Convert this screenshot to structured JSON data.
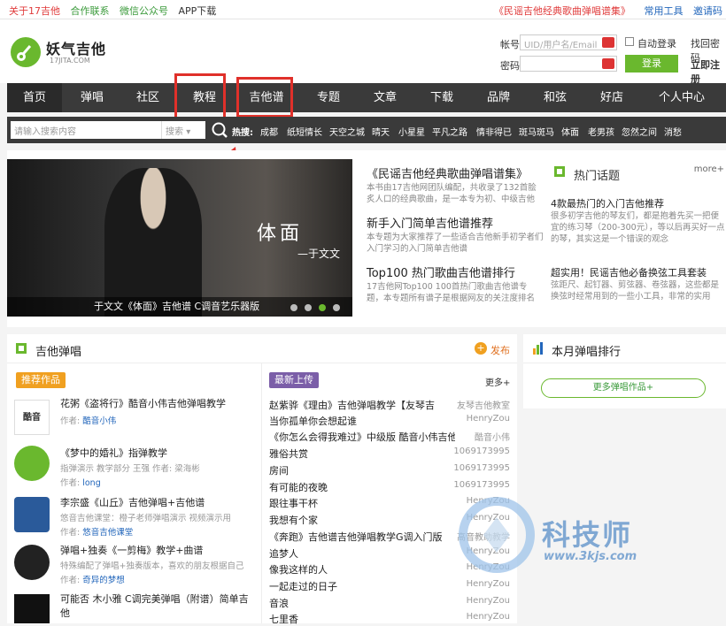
{
  "topbar": {
    "links": [
      "关于17吉他",
      "合作联系",
      "微信公众号",
      "APP下载"
    ],
    "promo": "《民谣吉他经典歌曲弹唱谱集》",
    "tools": "常用工具",
    "invite": "邀请码"
  },
  "header": {
    "logo_text": "妖气吉他",
    "logo_sub": "17JITA.COM",
    "account_label": "帐号",
    "account_placeholder": "UID/用户名/Email",
    "auto_login": "自动登录",
    "find_password": "找回密码",
    "password_label": "密码",
    "login_btn": "登录",
    "register": "立即注册"
  },
  "nav": [
    "首页",
    "弹唱",
    "社区",
    "教程",
    "吉他谱",
    "专题",
    "文章",
    "下载",
    "品牌",
    "和弦",
    "好店",
    "个人中心"
  ],
  "search": {
    "placeholder": "请输入搜索内容",
    "select": "搜索",
    "hot_label": "热搜:",
    "hot": [
      "成都",
      "纸短情长",
      "天空之城",
      "晴天",
      "小星星",
      "平凡之路",
      "情非得已",
      "斑马斑马",
      "体面",
      "老男孩",
      "忽然之间",
      "消愁"
    ]
  },
  "banner": {
    "title": "体面",
    "sub": "—于文文",
    "caption": "于文文《体面》吉他谱 C调音艺乐器版"
  },
  "articles": [
    {
      "title": "《民谣吉他经典歌曲弹唱谱集》",
      "desc": "本书由17吉他网团队编配，共收录了132首脍炙人口的经典歌曲，是一本专为初、中级吉他"
    },
    {
      "title": "新手入门简单吉他谱推荐",
      "desc": "本专题为大家推荐了一些适合吉他新手初学者们入门学习的入门简单吉他谱"
    },
    {
      "title": "Top100 热门歌曲吉他谱排行",
      "desc": "17吉他网Top100 100首热门歌曲吉他谱专题，本专题所有谱子是根据网友的关注度排名"
    }
  ],
  "hot_topics": {
    "title": "热门话题",
    "more": "more+",
    "items": [
      {
        "title": "4款最热门的入门吉他推荐",
        "desc": "很多初学吉他的琴友们，都是抱着先买一把便宜的练习琴（200-300元），等以后再买好一点的琴，其实这是一个错误的观念"
      },
      {
        "title": "超实用！民谣吉他必备换弦工具套装",
        "desc": "弦距尺、起钉器、剪弦器、卷弦器，这些都是换弦时经常用到的一些小工具，非常的实用"
      }
    ]
  },
  "guitar_section": {
    "title": "吉他弹唱",
    "publish": "发布",
    "recommend_tag": "推荐作品",
    "new_tag": "最新上传",
    "more": "更多+"
  },
  "recommend": [
    {
      "title": "花粥《盗将行》酷音小伟吉他弹唱教学",
      "author_label": "作者:",
      "author": "酷音小伟",
      "desc": ""
    },
    {
      "title": "《梦中的婚礼》指弹教学",
      "desc": "指弹演示 教学部分 王强 作者: 梁海彬",
      "author_label": "作者:",
      "author": "long"
    },
    {
      "title": "李宗盛《山丘》吉他弹唱+吉他谱",
      "desc": "悠音吉他课堂：橙子老师弹唱演示 视频演示用",
      "author_label": "作者:",
      "author": "悠音吉他课堂"
    },
    {
      "title": "弹唱+独奏《一剪梅》教学+曲谱",
      "desc": "特殊编配了弹唱+独奏版本，喜欢的朋友根据自己",
      "author_label": "作者:",
      "author": "奇异的梦想"
    },
    {
      "title": "可能否 木小雅 C调完美弹唱（附谱）简单吉他",
      "desc": "",
      "author_label": "",
      "author": ""
    }
  ],
  "new_uploads": [
    {
      "t": "赵紫骅《理由》吉他弹唱教学【友琴吉",
      "u": "友琴吉他教室"
    },
    {
      "t": "当你孤单你会想起谁",
      "u": "HenryZou"
    },
    {
      "t": "《你怎么会得我难过》中级版 酷音小伟吉他",
      "u": "酷音小伟"
    },
    {
      "t": "雅俗共赏",
      "u": "1069173995"
    },
    {
      "t": "房间",
      "u": "1069173995"
    },
    {
      "t": "有可能的夜晚",
      "u": "1069173995"
    },
    {
      "t": "跟往事干杯",
      "u": "HenryZou"
    },
    {
      "t": "我想有个家",
      "u": "HenryZou"
    },
    {
      "t": "《奔跑》吉他谱吉他弹唱教学G调入门版",
      "u": "高音教助教学"
    },
    {
      "t": "追梦人",
      "u": "HenryZou"
    },
    {
      "t": "像我这样的人",
      "u": "HenryZou"
    },
    {
      "t": "一起走过的日子",
      "u": "HenryZou"
    },
    {
      "t": "音浪",
      "u": "HenryZou"
    },
    {
      "t": "七里香",
      "u": "HenryZou"
    }
  ],
  "ranking": {
    "title": "本月弹唱排行",
    "more_btn": "更多弹唱作品+"
  },
  "watermark": {
    "name": "科技师",
    "url": "www.3kjs.com"
  },
  "colors": {
    "accent": "#6ab82e",
    "nav_bg": "#3a3a3a",
    "highlight": "#e0302a",
    "tag_orange": "#f0a020",
    "tag_purple": "#7b5ea8"
  }
}
